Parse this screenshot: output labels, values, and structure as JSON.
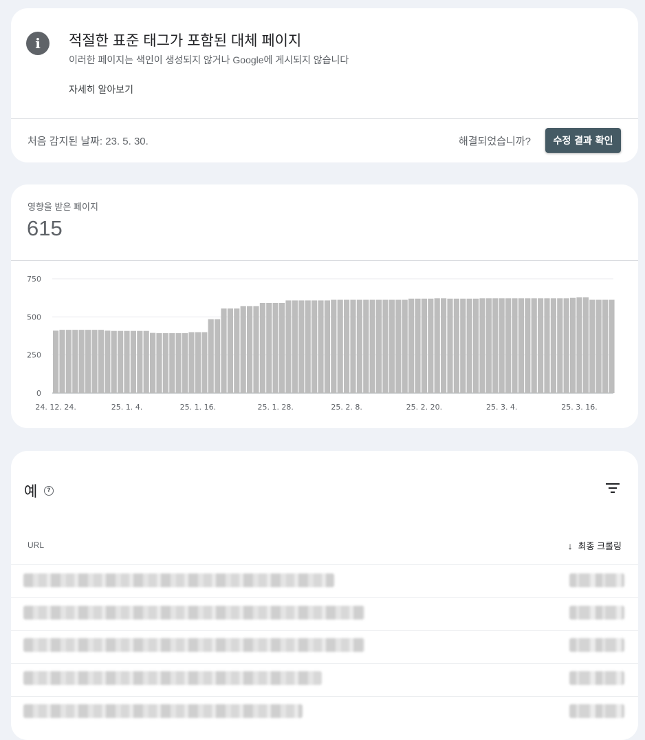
{
  "issue": {
    "icon": "info-icon",
    "title": "적절한 표준 태그가 포함된 대체 페이지",
    "subtitle": "이러한 페이지는 색인이 생성되지 않거나 Google에 게시되지 않습니다",
    "learn_more": "자세히 알아보기",
    "first_detected": "처음 감지된 날짜: 23. 5. 30.",
    "resolved_question": "해결되었습니까?",
    "validate_button": "수정 결과 확인"
  },
  "summary": {
    "affected_label": "영향을 받은 페이지",
    "affected_count": "615"
  },
  "chart_data": {
    "type": "bar",
    "x_tick_labels": [
      "24. 12. 24.",
      "25. 1. 4.",
      "25. 1. 16.",
      "25. 1. 28.",
      "25. 2. 8.",
      "25. 2. 20.",
      "25. 3. 4.",
      "25. 3. 16."
    ],
    "y_ticks": [
      0,
      250,
      500,
      750
    ],
    "ylim": [
      0,
      750
    ],
    "grid": true,
    "bar_color": "#bdbdbd",
    "values": [
      410,
      415,
      415,
      415,
      415,
      415,
      415,
      415,
      410,
      408,
      408,
      408,
      408,
      408,
      408,
      395,
      393,
      393,
      393,
      393,
      393,
      400,
      400,
      400,
      485,
      485,
      555,
      555,
      555,
      570,
      570,
      570,
      592,
      592,
      592,
      592,
      608,
      608,
      608,
      608,
      608,
      608,
      608,
      612,
      612,
      612,
      612,
      612,
      612,
      612,
      612,
      612,
      612,
      612,
      612,
      620,
      620,
      620,
      620,
      622,
      622,
      620,
      620,
      620,
      620,
      620,
      622,
      622,
      622,
      622,
      622,
      622,
      622,
      622,
      622,
      622,
      622,
      622,
      622,
      622,
      625,
      628,
      628,
      612,
      612,
      612,
      612
    ]
  },
  "examples": {
    "title": "예",
    "help_icon": "help-circle-icon",
    "filter_icon": "filter-icon",
    "col_url": "URL",
    "col_last_crawled": "최종 크롤링",
    "sort_icon": "arrow-down-icon"
  },
  "colors": {
    "page_bg": "#eff2f7",
    "button_bg": "#455a64",
    "info_icon_bg": "#5f6368"
  }
}
